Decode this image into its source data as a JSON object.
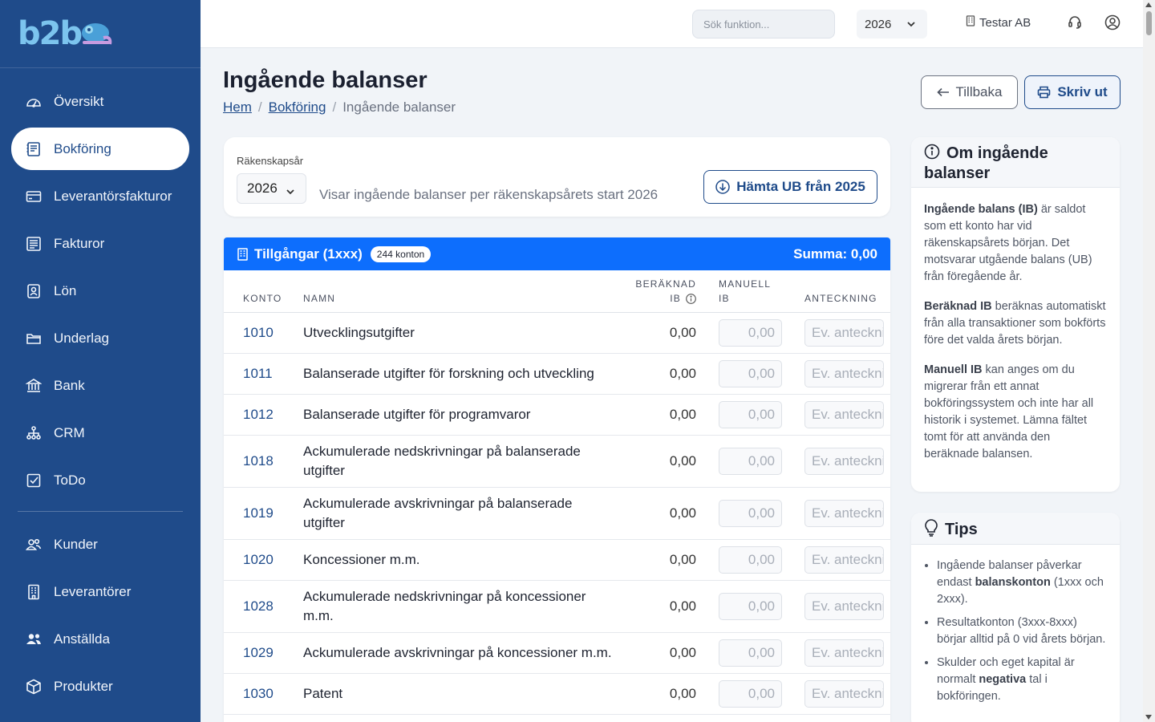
{
  "app": {
    "logo": "b2b",
    "search_placeholder": "Sök funktion...",
    "year": "2026",
    "company": "Testar AB"
  },
  "sidebar": {
    "items": [
      {
        "label": "Översikt",
        "icon": "gauge-icon"
      },
      {
        "label": "Bokföring",
        "icon": "ledger-icon",
        "active": true
      },
      {
        "label": "Leverantörsfakturor",
        "icon": "credit-card-icon"
      },
      {
        "label": "Fakturor",
        "icon": "invoice-icon"
      },
      {
        "label": "Lön",
        "icon": "badge-icon"
      },
      {
        "label": "Underlag",
        "icon": "folder-icon"
      },
      {
        "label": "Bank",
        "icon": "bank-icon"
      },
      {
        "label": "CRM",
        "icon": "org-chart-icon"
      },
      {
        "label": "ToDo",
        "icon": "checkbox-icon"
      }
    ],
    "items2": [
      {
        "label": "Kunder",
        "icon": "people-icon"
      },
      {
        "label": "Leverantörer",
        "icon": "building-icon"
      },
      {
        "label": "Anställda",
        "icon": "people-fill-icon"
      },
      {
        "label": "Produkter",
        "icon": "box-icon"
      }
    ]
  },
  "page": {
    "title": "Ingående balanser",
    "breadcrumb": [
      "Hem",
      "Bokföring",
      "Ingående balanser"
    ],
    "back_label": "Tillbaka",
    "print_label": "Skriv ut"
  },
  "fiscal": {
    "label": "Räkenskapsår",
    "year": "2026",
    "description": "Visar ingående balanser per räkenskapsårets start 2026",
    "fetch_label": "Hämta UB från 2025"
  },
  "table": {
    "title": "Tillgångar (1xxx)",
    "badge": "244 konton",
    "sum": "Summa: 0,00",
    "headers": {
      "konto": "KONTO",
      "namn": "NAMN",
      "beraknad_1": "BERÄKNAD",
      "beraknad_2": "IB",
      "manuell_1": "MANUELL",
      "manuell_2": "IB",
      "anteckning": "ANTECKNING"
    },
    "manual_placeholder": "0,00",
    "note_placeholder": "Ev. anteckning",
    "rows": [
      {
        "konto": "1010",
        "namn": "Utvecklingsutgifter",
        "beraknad": "0,00"
      },
      {
        "konto": "1011",
        "namn": "Balanserade utgifter för forskning och utveckling",
        "beraknad": "0,00"
      },
      {
        "konto": "1012",
        "namn": "Balanserade utgifter för programvaror",
        "beraknad": "0,00"
      },
      {
        "konto": "1018",
        "namn": "Ackumulerade nedskrivningar på balanserade utgifter",
        "beraknad": "0,00"
      },
      {
        "konto": "1019",
        "namn": "Ackumulerade avskrivningar på balanserade utgifter",
        "beraknad": "0,00"
      },
      {
        "konto": "1020",
        "namn": "Koncessioner m.m.",
        "beraknad": "0,00"
      },
      {
        "konto": "1028",
        "namn": "Ackumulerade nedskrivningar på koncessioner m.m.",
        "beraknad": "0,00"
      },
      {
        "konto": "1029",
        "namn": "Ackumulerade avskrivningar på koncessioner m.m.",
        "beraknad": "0,00"
      },
      {
        "konto": "1030",
        "namn": "Patent",
        "beraknad": "0,00"
      }
    ]
  },
  "info": {
    "title": "Om ingående balanser",
    "p1_bold": "Ingående balans (IB)",
    "p1_text": " är saldot som ett konto har vid räkenskapsårets början. Det motsvarar utgående balans (UB) från föregående år.",
    "p2_bold": "Beräknad IB",
    "p2_text": " beräknas automatiskt från alla transaktioner som bokförts före det valda årets början.",
    "p3_bold": "Manuell IB",
    "p3_text": " kan anges om du migrerar från ett annat bokföringssystem och inte har all historik i systemet. Lämna fältet tomt för att använda den beräknade balansen."
  },
  "tips": {
    "title": "Tips",
    "t1_pre": "Ingående balanser påverkar endast ",
    "t1_bold": "balanskonton",
    "t1_post": " (1xxx och 2xxx).",
    "t2": "Resultatkonton (3xxx-8xxx) börjar alltid på 0 vid årets början.",
    "t3_pre": "Skulder och eget kapital är normalt ",
    "t3_bold": "negativa",
    "t3_post": " tal i bokföringen."
  }
}
